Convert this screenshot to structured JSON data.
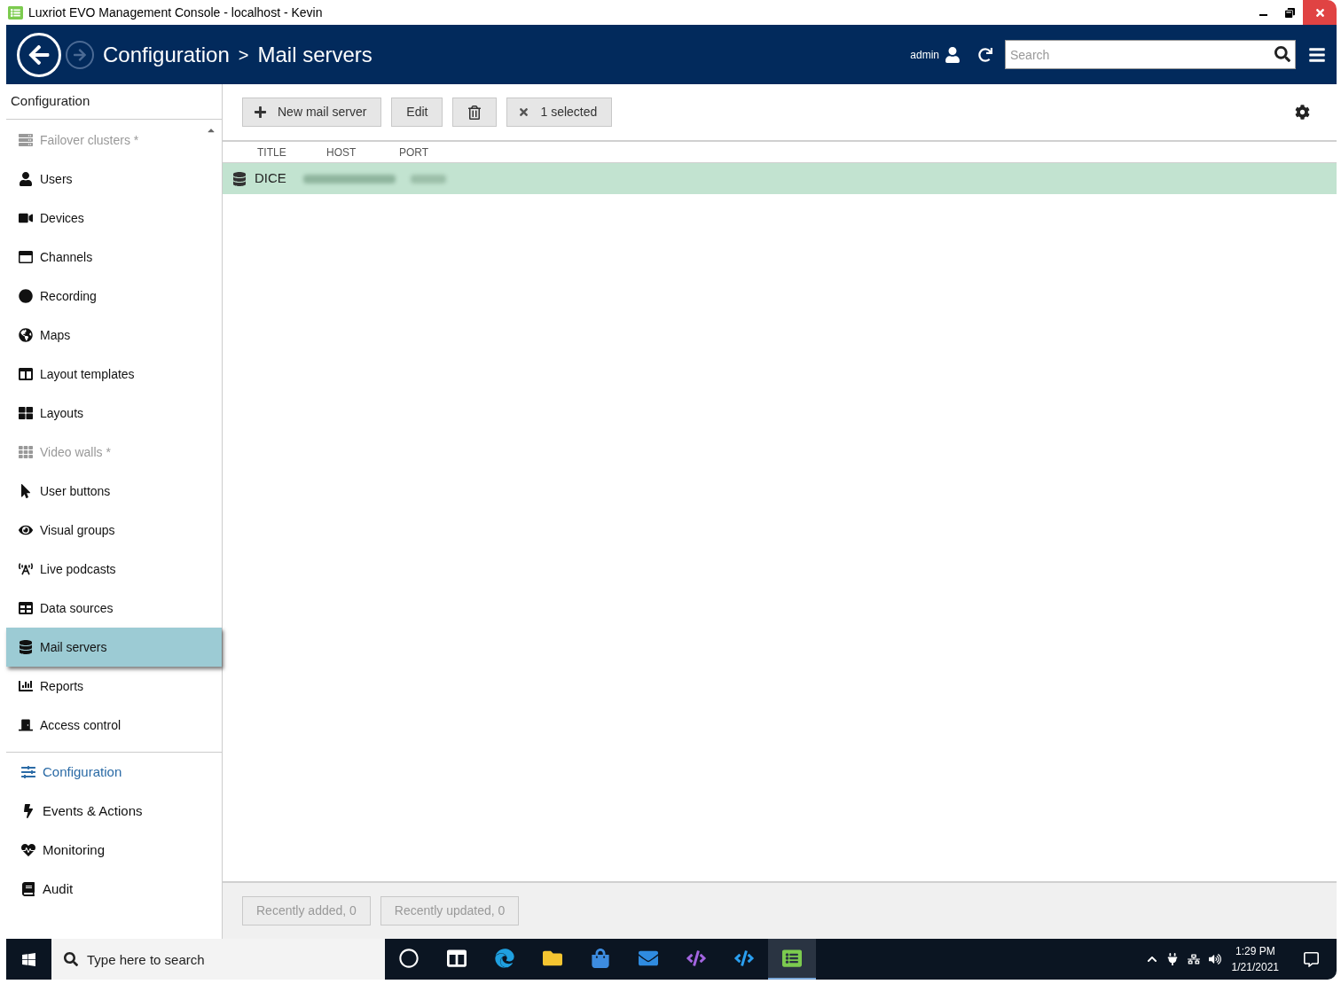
{
  "window": {
    "title": "Luxriot EVO Management Console - localhost - Kevin"
  },
  "header": {
    "breadcrumb": [
      "Configuration",
      ">",
      "Mail servers"
    ],
    "user": "admin",
    "search": {
      "placeholder": "Search"
    }
  },
  "sidebar": {
    "heading": "Configuration",
    "items": [
      {
        "label": "Failover clusters *",
        "disabled": true,
        "selected": false
      },
      {
        "label": "Users",
        "disabled": false,
        "selected": false
      },
      {
        "label": "Devices",
        "disabled": false,
        "selected": false
      },
      {
        "label": "Channels",
        "disabled": false,
        "selected": false
      },
      {
        "label": "Recording",
        "disabled": false,
        "selected": false
      },
      {
        "label": "Maps",
        "disabled": false,
        "selected": false
      },
      {
        "label": "Layout templates",
        "disabled": false,
        "selected": false
      },
      {
        "label": "Layouts",
        "disabled": false,
        "selected": false
      },
      {
        "label": "Video walls *",
        "disabled": true,
        "selected": false
      },
      {
        "label": "User buttons",
        "disabled": false,
        "selected": false
      },
      {
        "label": "Visual groups",
        "disabled": false,
        "selected": false
      },
      {
        "label": "Live podcasts",
        "disabled": false,
        "selected": false
      },
      {
        "label": "Data sources",
        "disabled": false,
        "selected": false
      },
      {
        "label": "Mail servers",
        "disabled": false,
        "selected": true
      },
      {
        "label": "Reports",
        "disabled": false,
        "selected": false
      },
      {
        "label": "Access control",
        "disabled": false,
        "selected": false
      }
    ],
    "sections": [
      {
        "label": "Configuration",
        "selected": true
      },
      {
        "label": "Events & Actions",
        "selected": false
      },
      {
        "label": "Monitoring",
        "selected": false
      },
      {
        "label": "Audit",
        "selected": false
      }
    ]
  },
  "toolbar": {
    "buttons": [
      {
        "kind": "new",
        "label": "New mail server"
      },
      {
        "kind": "edit",
        "label": "Edit"
      },
      {
        "kind": "delete"
      },
      {
        "kind": "clear",
        "label": "1 selected"
      }
    ]
  },
  "table": {
    "columns": [
      "TITLE",
      "HOST",
      "PORT"
    ],
    "rows": [
      {
        "title": "DICE",
        "selected": true
      }
    ]
  },
  "footer": {
    "buttons": [
      {
        "label": "Recently added, 0",
        "disabled": true
      },
      {
        "label": "Recently updated, 0",
        "disabled": true
      }
    ]
  },
  "taskbar": {
    "search": {
      "placeholder": "Type here to search"
    },
    "apps": [
      {
        "kind": "cortana",
        "active": false
      },
      {
        "kind": "taskview",
        "active": false
      },
      {
        "kind": "edge",
        "active": false
      },
      {
        "kind": "explorer",
        "active": false
      },
      {
        "kind": "store",
        "active": false
      },
      {
        "kind": "mail",
        "active": false
      },
      {
        "kind": "vs",
        "active": false
      },
      {
        "kind": "vscode",
        "active": false
      },
      {
        "kind": "luxriot",
        "active": true
      }
    ],
    "time": "1:29 PM",
    "date": "1/21/2021"
  }
}
